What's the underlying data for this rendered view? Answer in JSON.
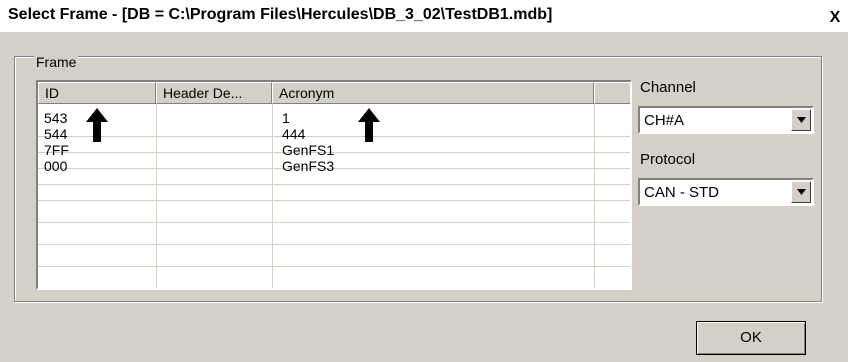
{
  "window": {
    "title": "Select Frame - [DB = C:\\Program Files\\Hercules\\DB_3_02\\TestDB1.mdb]",
    "close_glyph": "X"
  },
  "frame": {
    "group_label": "Frame",
    "columns": [
      "ID",
      "Header De...",
      "Acronym"
    ],
    "rows": [
      {
        "id": "543",
        "header": "",
        "acronym": "1"
      },
      {
        "id": "544",
        "header": "",
        "acronym": "444"
      },
      {
        "id": "7FF",
        "header": "",
        "acronym": "GenFS1"
      },
      {
        "id": "000",
        "header": "",
        "acronym": "GenFS3"
      }
    ],
    "annotations": [
      "up-arrow-icon",
      "up-arrow-icon"
    ]
  },
  "channel": {
    "label": "Channel",
    "value": "CH#A"
  },
  "protocol": {
    "label": "Protocol",
    "value": "CAN - STD"
  },
  "buttons": {
    "ok_label": "OK"
  }
}
